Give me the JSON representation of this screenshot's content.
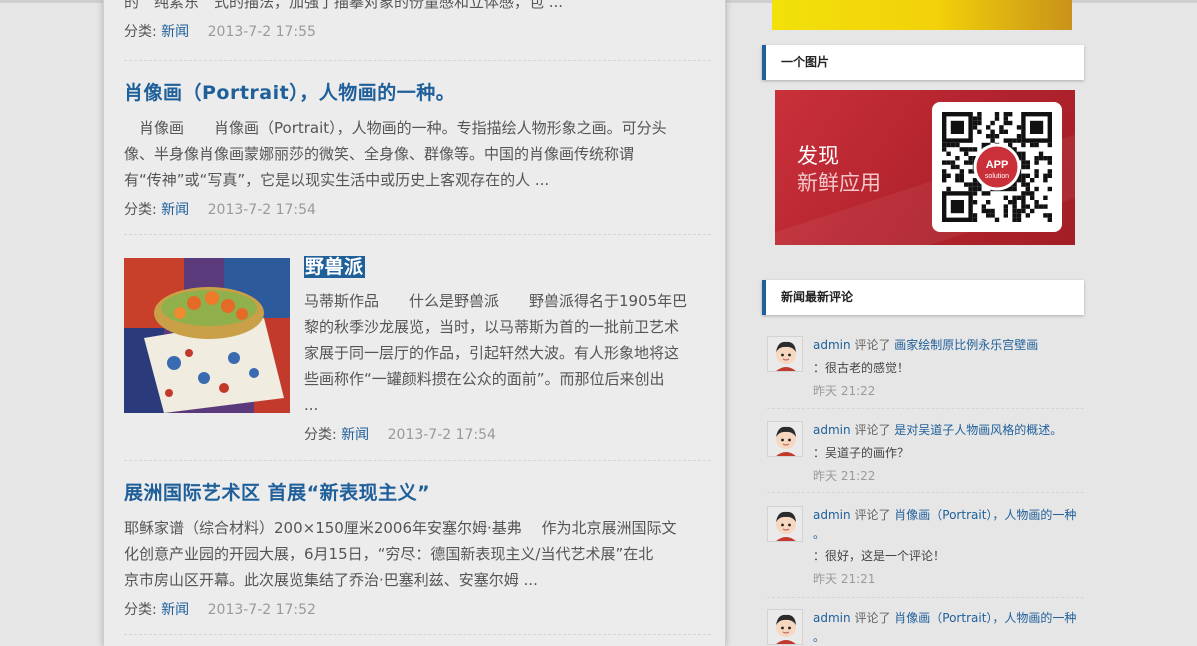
{
  "posts": [
    {
      "excerpt_tail": "的　纯素东　式的描法，加强了描摹对象的份量感和立体感，包 ...",
      "category_label": "分类:",
      "category": "新闻",
      "date": "2013-7-2 17:55"
    },
    {
      "title": "肖像画（Portrait），人物画的一种。",
      "excerpt_lines": [
        "　肖像画　　肖像画（Portrait），人物画的一种。专指描绘人物形象之画。可分头",
        "像、半身像肖像画蒙娜丽莎的微笑、全身像、群像等。中国的肖像画传统称谓",
        "有“传神”或“写真”，它是以现实生活中或历史上客观存在的人 ..."
      ],
      "category_label": "分类:",
      "category": "新闻",
      "date": "2013-7-2 17:54"
    },
    {
      "title": "野兽派",
      "excerpt_lines": [
        "马蒂斯作品　　什么是野兽派　　野兽派得名于1905年巴",
        "黎的秋季沙龙展览，当时，以马蒂斯为首的一批前卫艺术",
        "家展于同一层厅的作品，引起轩然大波。有人形象地将这",
        "些画称作“一罐颜料掼在公众的面前”。而那位后来创出",
        "..."
      ],
      "category_label": "分类:",
      "category": "新闻",
      "date": "2013-7-2 17:54"
    },
    {
      "title": "展洲国际艺术区 首展“新表现主义”",
      "excerpt_lines": [
        "耶稣家谱（综合材料）200×150厘米2006年安塞尔姆·基弗　 作为北京展洲国际文",
        "化创意产业园的开园大展，6月15日，“穷尽：德国新表现主义/当代艺术展”在北",
        "京市房山区开幕。此次展览集结了乔治·巴塞利兹、安塞尔姆 ..."
      ],
      "category_label": "分类:",
      "category": "新闻",
      "date": "2013-7-2 17:52"
    }
  ],
  "sidebar": {
    "image_widget_title": "一个图片",
    "ad_line1": "发现",
    "ad_line2": "新鲜应用",
    "qr_badge_line1": "APP",
    "qr_badge_line2": "solution",
    "comments_widget_title": "新闻最新评论",
    "comments": [
      {
        "user": "admin",
        "verb": "评论了",
        "post": "画家绘制原比例永乐宫壁画",
        "post_cont": "",
        "body": "：很古老的感觉！",
        "time": "昨天 21:22"
      },
      {
        "user": "admin",
        "verb": "评论了",
        "post": "是对吴道子人物画风格的概述。",
        "post_cont": "",
        "body": "：吴道子的画作？",
        "time": "昨天 21:22"
      },
      {
        "user": "admin",
        "verb": "评论了",
        "post": "肖像画（Portrait），人物画的一种",
        "post_cont": "。",
        "body": "：很好，这是一个评论！",
        "time": "昨天 21:21"
      },
      {
        "user": "admin",
        "verb": "评论了",
        "post": "肖像画（Portrait），人物画的一种",
        "post_cont": "。",
        "body": "",
        "time": ""
      }
    ]
  },
  "colors": {
    "link": "#1f5f9a",
    "widget_accent": "#1f5f9a",
    "ad_red": "#b2232d",
    "date_gray": "#9a9a9a"
  }
}
